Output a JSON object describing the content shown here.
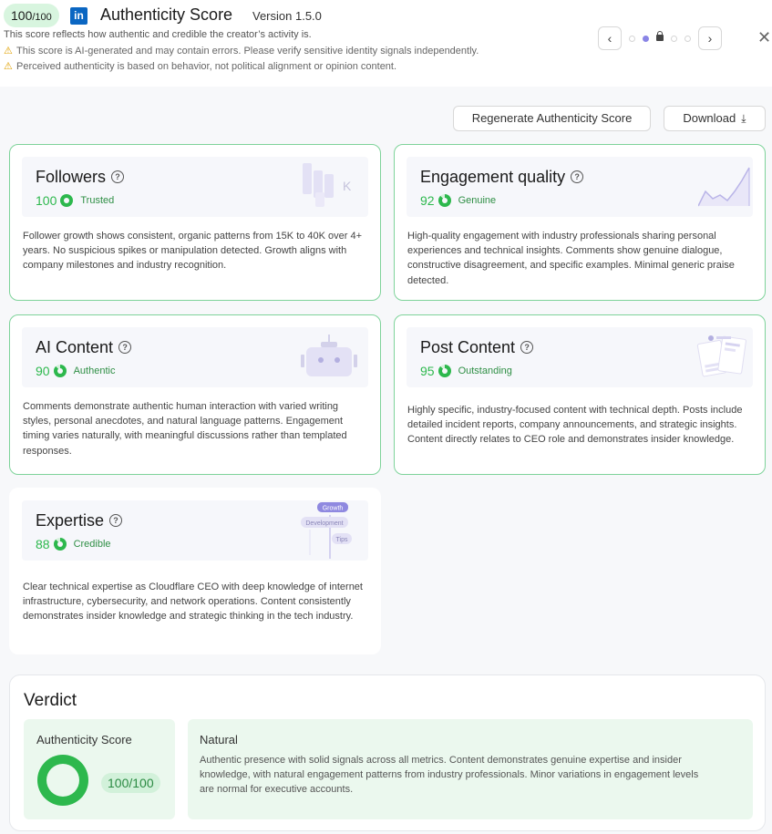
{
  "header": {
    "score_value": "100",
    "score_den": "/100",
    "title": "Authenticity Score",
    "version": "Version 1.5.0",
    "description": "This score reflects how authentic and credible the creator’s activity is.",
    "warnings": [
      "This score is AI-generated and may contain errors. Please verify sensitive identity signals independently.",
      "Perceived authenticity is based on behavior, not political alignment or opinion content."
    ],
    "pager": {
      "prev": "‹",
      "next": "›",
      "active_index": 1,
      "count": 5
    },
    "close": "✕"
  },
  "actions": {
    "regenerate_label": "Regenerate Authenticity Score",
    "download_label": "Download"
  },
  "cards": {
    "followers": {
      "title": "Followers",
      "score": "100",
      "label": "Trusted",
      "illus_text": "K",
      "desc": "Follower growth shows consistent, organic patterns from 15K to 40K over 4+ years. No suspicious spikes or manipulation detected. Growth aligns with company milestones and industry recognition."
    },
    "engagement": {
      "title": "Engagement quality",
      "score": "92",
      "label": "Genuine",
      "desc": "High-quality engagement with industry professionals sharing personal experiences and technical insights. Comments show genuine dialogue, constructive disagreement, and specific examples. Minimal generic praise detected."
    },
    "ai_content": {
      "title": "AI Content",
      "score": "90",
      "label": "Authentic",
      "desc": "Comments demonstrate authentic human interaction with varied writing styles, personal anecdotes, and natural language patterns. Engagement timing varies naturally, with meaningful discussions rather than templated responses."
    },
    "post_content": {
      "title": "Post Content",
      "score": "95",
      "label": "Outstanding",
      "desc": "Highly specific, industry-focused content with technical depth. Posts include detailed incident reports, company announcements, and strategic insights. Content directly relates to CEO role and demonstrates insider knowledge."
    },
    "expertise": {
      "title": "Expertise",
      "score": "88",
      "label": "Credible",
      "illus_tags": [
        "Growth",
        "Development",
        "Tips"
      ],
      "desc": "Clear technical expertise as Cloudflare CEO with deep knowledge of internet infrastructure, cybersecurity, and network operations. Content consistently demonstrates insider knowledge and strategic thinking in the tech industry."
    }
  },
  "verdict": {
    "title": "Verdict",
    "auth_label": "Authenticity Score",
    "auth_value": "100/100",
    "auth_fraction": 1.0,
    "natural_title": "Natural",
    "natural_desc": "Authentic presence with solid signals across all metrics. Content demonstrates genuine expertise and insider knowledge, with natural engagement patterns from industry professionals. Minor variations in engagement levels are normal for executive accounts."
  },
  "colors": {
    "accent_green": "#2db84d",
    "card_border": "#7ed39a",
    "dot_active": "#8a85e6",
    "linkedin": "#0a66c2"
  }
}
